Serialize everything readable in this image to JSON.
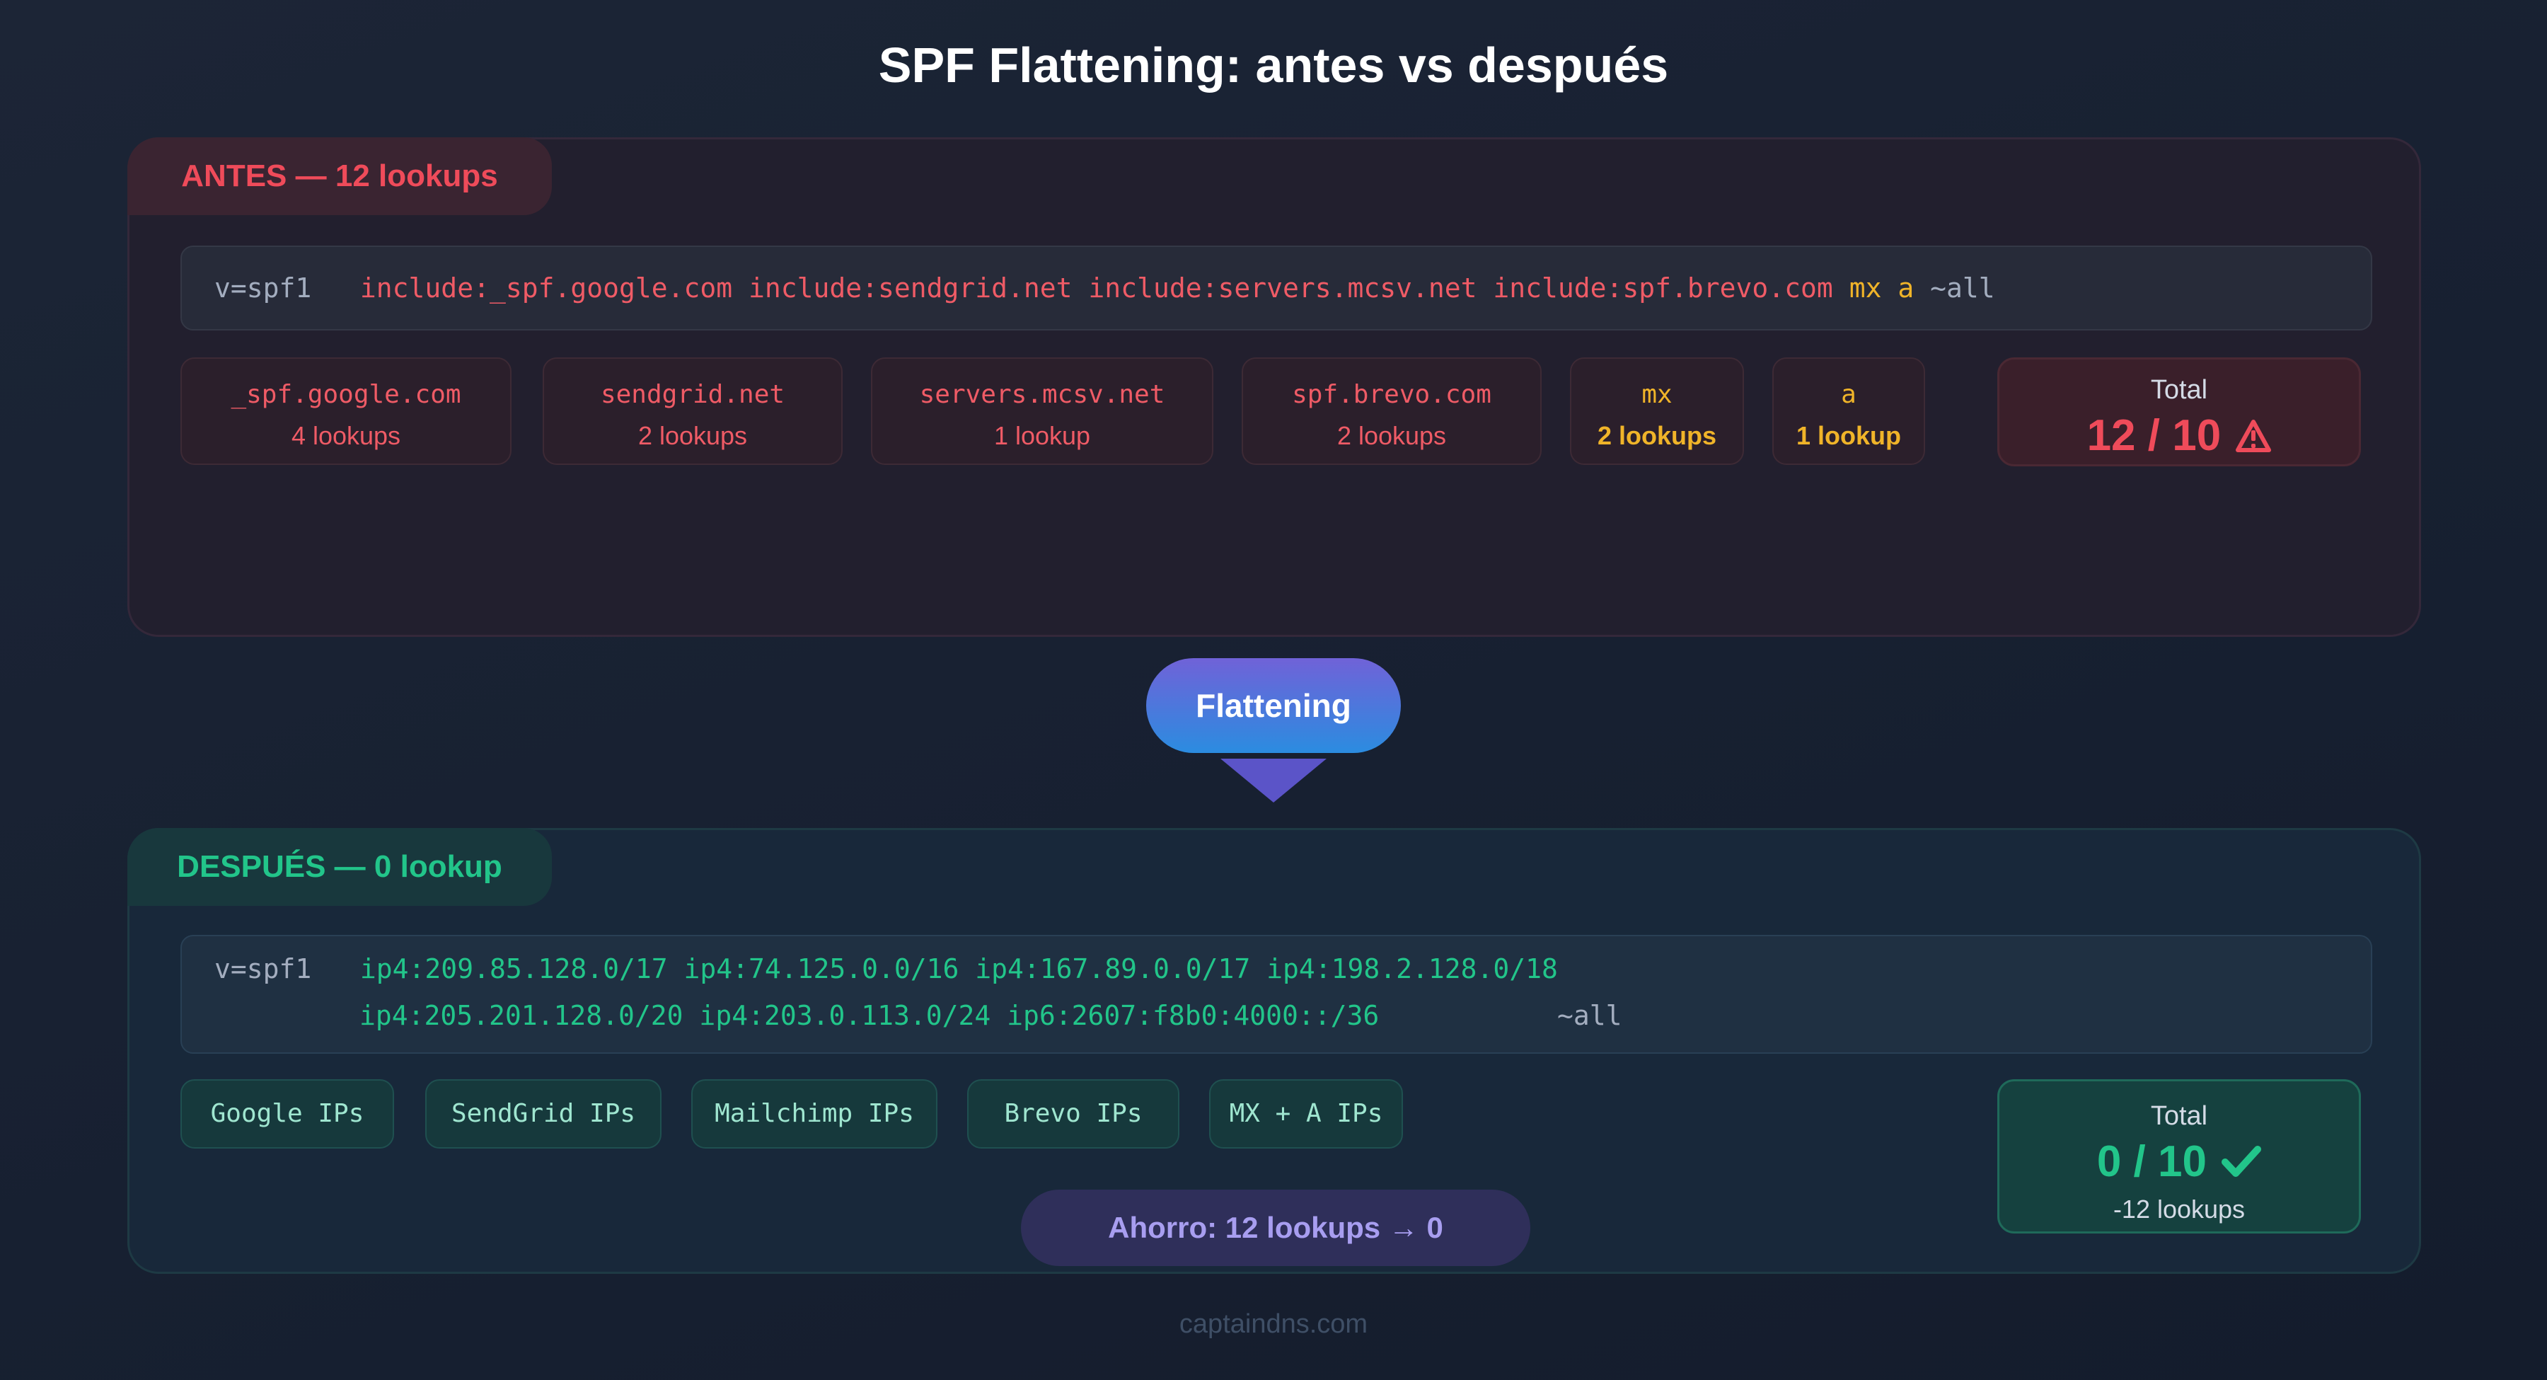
{
  "title": "SPF Flattening: antes vs después",
  "before": {
    "tab_label": "ANTES — 12 lookups",
    "record": {
      "version": "v=spf1",
      "includes": "include:_spf.google.com include:sendgrid.net include:servers.mcsv.net include:spf.brevo.com",
      "mx": "mx",
      "a": "a",
      "all": "~all"
    },
    "chips": [
      {
        "name": "_spf.google.com",
        "count": "4 lookups"
      },
      {
        "name": "sendgrid.net",
        "count": "2 lookups"
      },
      {
        "name": "servers.mcsv.net",
        "count": "1 lookup"
      },
      {
        "name": "spf.brevo.com",
        "count": "2 lookups"
      },
      {
        "name": "mx",
        "count": "2 lookups"
      },
      {
        "name": "a",
        "count": "1 lookup"
      }
    ],
    "total": {
      "label": "Total",
      "value": "12 / 10",
      "status_icon": "warning-triangle-icon",
      "status_color": "#ef4b5a"
    }
  },
  "flatten_label": "Flattening",
  "after": {
    "tab_label": "DESPUÉS — 0 lookup",
    "record": {
      "version": "v=spf1",
      "line1": "ip4:209.85.128.0/17 ip4:74.125.0.0/16 ip4:167.89.0.0/17 ip4:198.2.128.0/18",
      "line2": "ip4:205.201.128.0/20 ip4:203.0.113.0/24 ip6:2607:f8b0:4000::/36",
      "all": "~all"
    },
    "chips": [
      "Google IPs",
      "SendGrid IPs",
      "Mailchimp IPs",
      "Brevo IPs",
      "MX + A IPs"
    ],
    "savings": "Ahorro: 12 lookups → 0",
    "total": {
      "label": "Total",
      "value": "0 / 10",
      "note": "-12 lookups",
      "status_icon": "check-icon",
      "status_color": "#22c58a"
    }
  },
  "footer": "captaindns.com"
}
